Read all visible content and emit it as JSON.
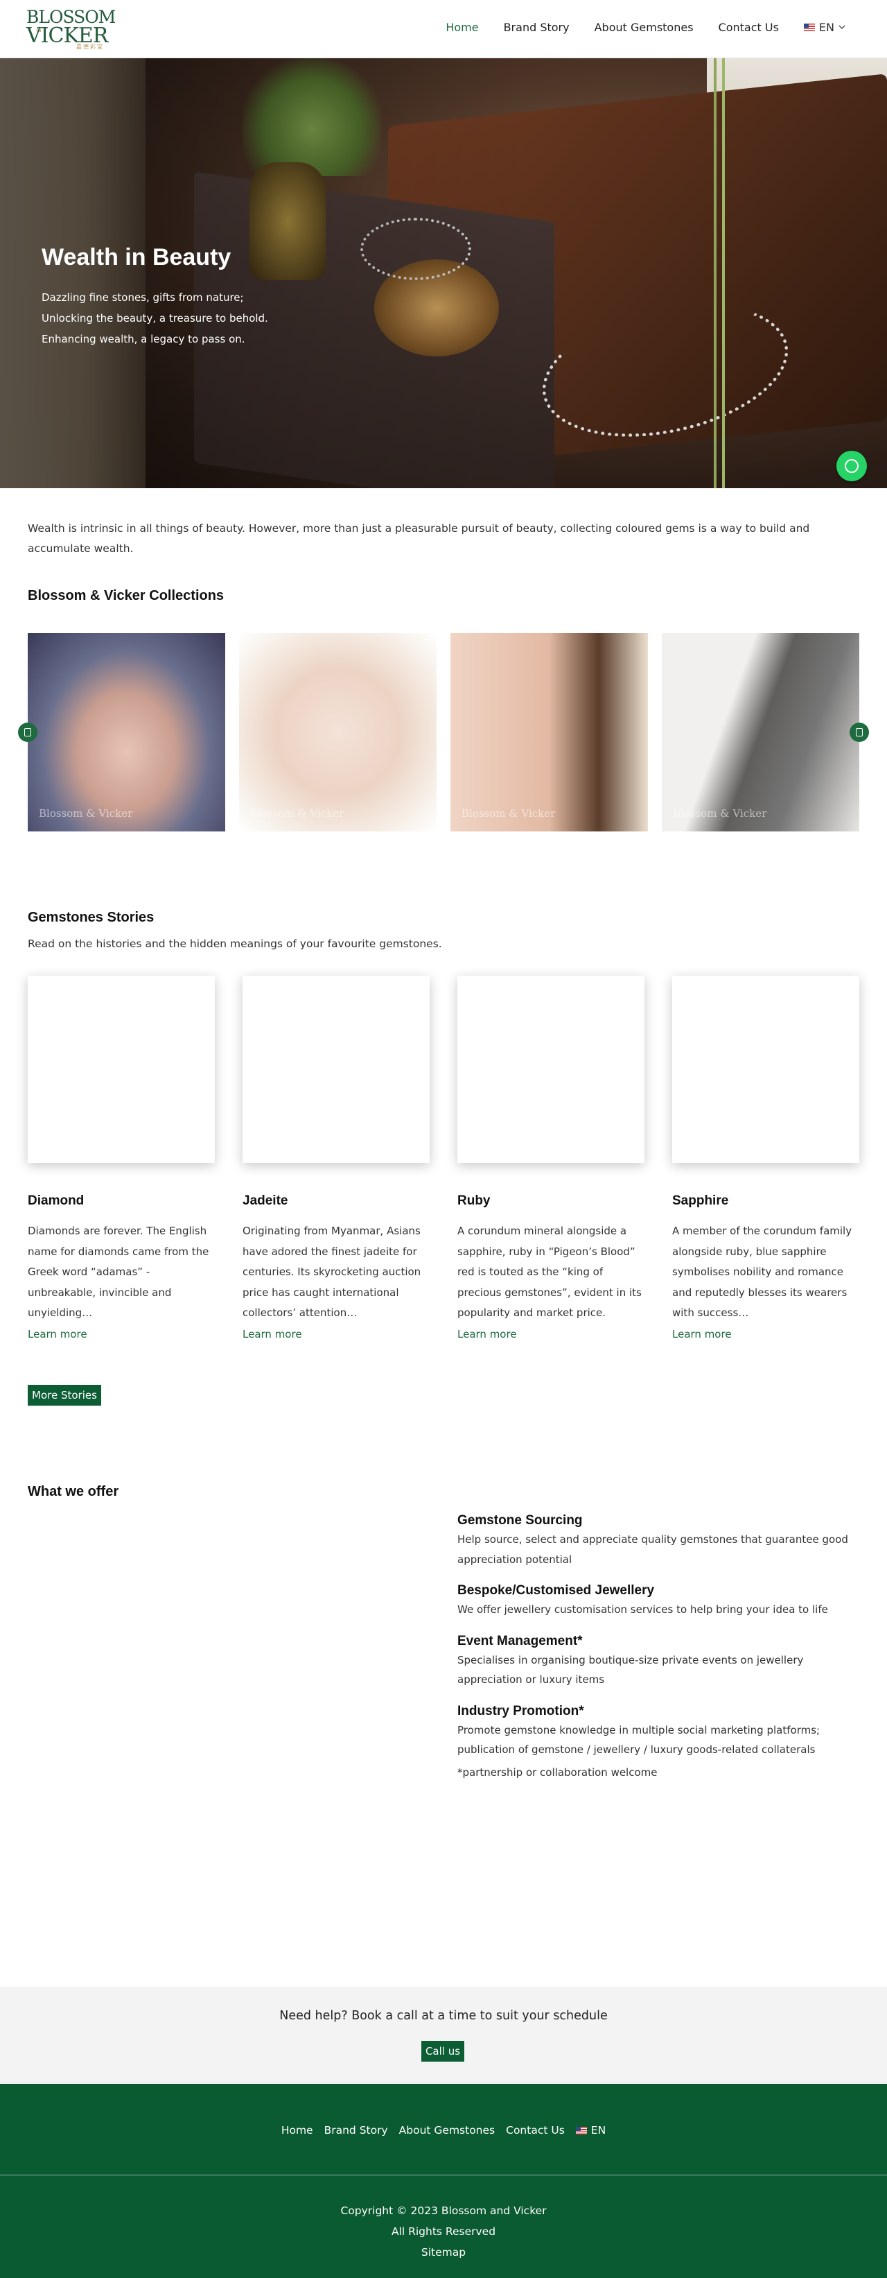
{
  "header": {
    "logo": {
      "line1": "BLOSSOM",
      "line2": "VICKER",
      "amp": "&",
      "cn": "嘉德彩宝"
    },
    "nav": [
      "Home",
      "Brand Story",
      "About Gemstones",
      "Contact Us"
    ],
    "lang": "EN",
    "active_nav": "Home",
    "accent_color": "#1e6b3f"
  },
  "hero": {
    "title": "Wealth in Beauty",
    "lines": [
      "Dazzling fine stones, gifts from nature;",
      "Unlocking the beauty, a treasure to behold.",
      "Enhancing wealth, a legacy to pass on."
    ],
    "chat_icon": "whatsapp-icon"
  },
  "intro": "Wealth is intrinsic in all things of beauty. However, more than just a pleasurable pursuit of beauty, collecting coloured gems is a way to build and accumulate wealth.",
  "collections": {
    "title": "Blossom & Vicker Collections",
    "watermark": "Blossom & Vicker",
    "items": [
      "collection-image-1",
      "collection-image-2",
      "collection-image-3",
      "collection-image-4"
    ]
  },
  "stories": {
    "title": "Gemstones Stories",
    "subtitle": "Read on the histories and the hidden meanings of your favourite gemstones.",
    "items": [
      {
        "name": "Diamond",
        "text": "Diamonds are forever. The English name for diamonds came from the Greek word “adamas” - unbreakable, invincible and unyielding…",
        "link": "Learn more"
      },
      {
        "name": "Jadeite",
        "text": "Originating from Myanmar, Asians have adored the finest jadeite for centuries. Its skyrocketing auction price has caught international collectors’ attention…",
        "link": "Learn more"
      },
      {
        "name": "Ruby",
        "text": "A corundum mineral alongside a sapphire, ruby in “Pigeon’s Blood” red is touted as the “king of precious gemstones”, evident in its popularity and market price.",
        "link": "Learn more"
      },
      {
        "name": "Sapphire",
        "text": "A member of the corundum family alongside ruby, blue sapphire symbolises nobility and romance and reputedly blesses its wearers with success…",
        "link": "Learn more"
      }
    ],
    "more_button": "More Stories"
  },
  "offer": {
    "title": "What we offer",
    "items": [
      {
        "title": "Gemstone Sourcing",
        "text": "Help source, select and appreciate quality gemstones that guarantee good appreciation potential"
      },
      {
        "title": "Bespoke/Customised Jewellery",
        "text": "We offer jewellery customisation services to help bring your idea to life"
      },
      {
        "title": "Event Management*",
        "text": "Specialises in organising boutique-size private events on jewellery appreciation or luxury items"
      },
      {
        "title": "Industry Promotion*",
        "text": "Promote gemstone knowledge in multiple social marketing platforms; publication of gemstone / jewellery / luxury goods-related collaterals"
      }
    ],
    "note": "*partnership or collaboration welcome"
  },
  "cta": {
    "question": "Need help? Book a call at a time to suit your schedule",
    "button": "Call us"
  },
  "footer": {
    "nav": [
      "Home",
      "Brand Story",
      "About Gemstones",
      "Contact Us"
    ],
    "lang": "EN",
    "copyright": "Copyright © 2023 Blossom and Vicker",
    "rights": "All Rights Reserved",
    "sitemap": "Sitemap",
    "bg_color": "#0a5a32"
  }
}
